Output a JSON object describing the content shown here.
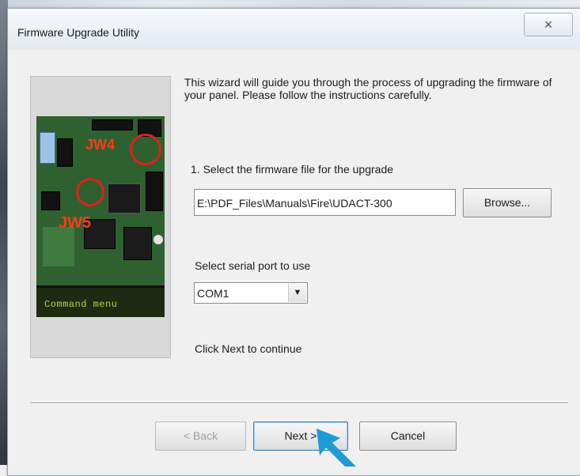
{
  "window": {
    "title": "Firmware Upgrade Utility",
    "close_glyph": "✕"
  },
  "image_panel": {
    "jumper_labels": [
      "JW4",
      "JW5"
    ],
    "lcd_text": "Command menu"
  },
  "content": {
    "description": "This wizard will guide you through the process of upgrading the firmware of your panel. Please follow the instructions carefully.",
    "step1_label": "1. Select the firmware file for the upgrade",
    "file_path": "E:\\PDF_Files\\Manuals\\Fire\\UDACT-300",
    "browse_label": "Browse...",
    "serial_label": "Select serial port to use",
    "serial_selected": "COM1",
    "continue_text": "Click Next to continue"
  },
  "buttons": {
    "back": "< Back",
    "next": "Next >",
    "cancel": "Cancel"
  },
  "colors": {
    "accent": "#1e9ad6",
    "jumper_highlight": "#e02020"
  }
}
